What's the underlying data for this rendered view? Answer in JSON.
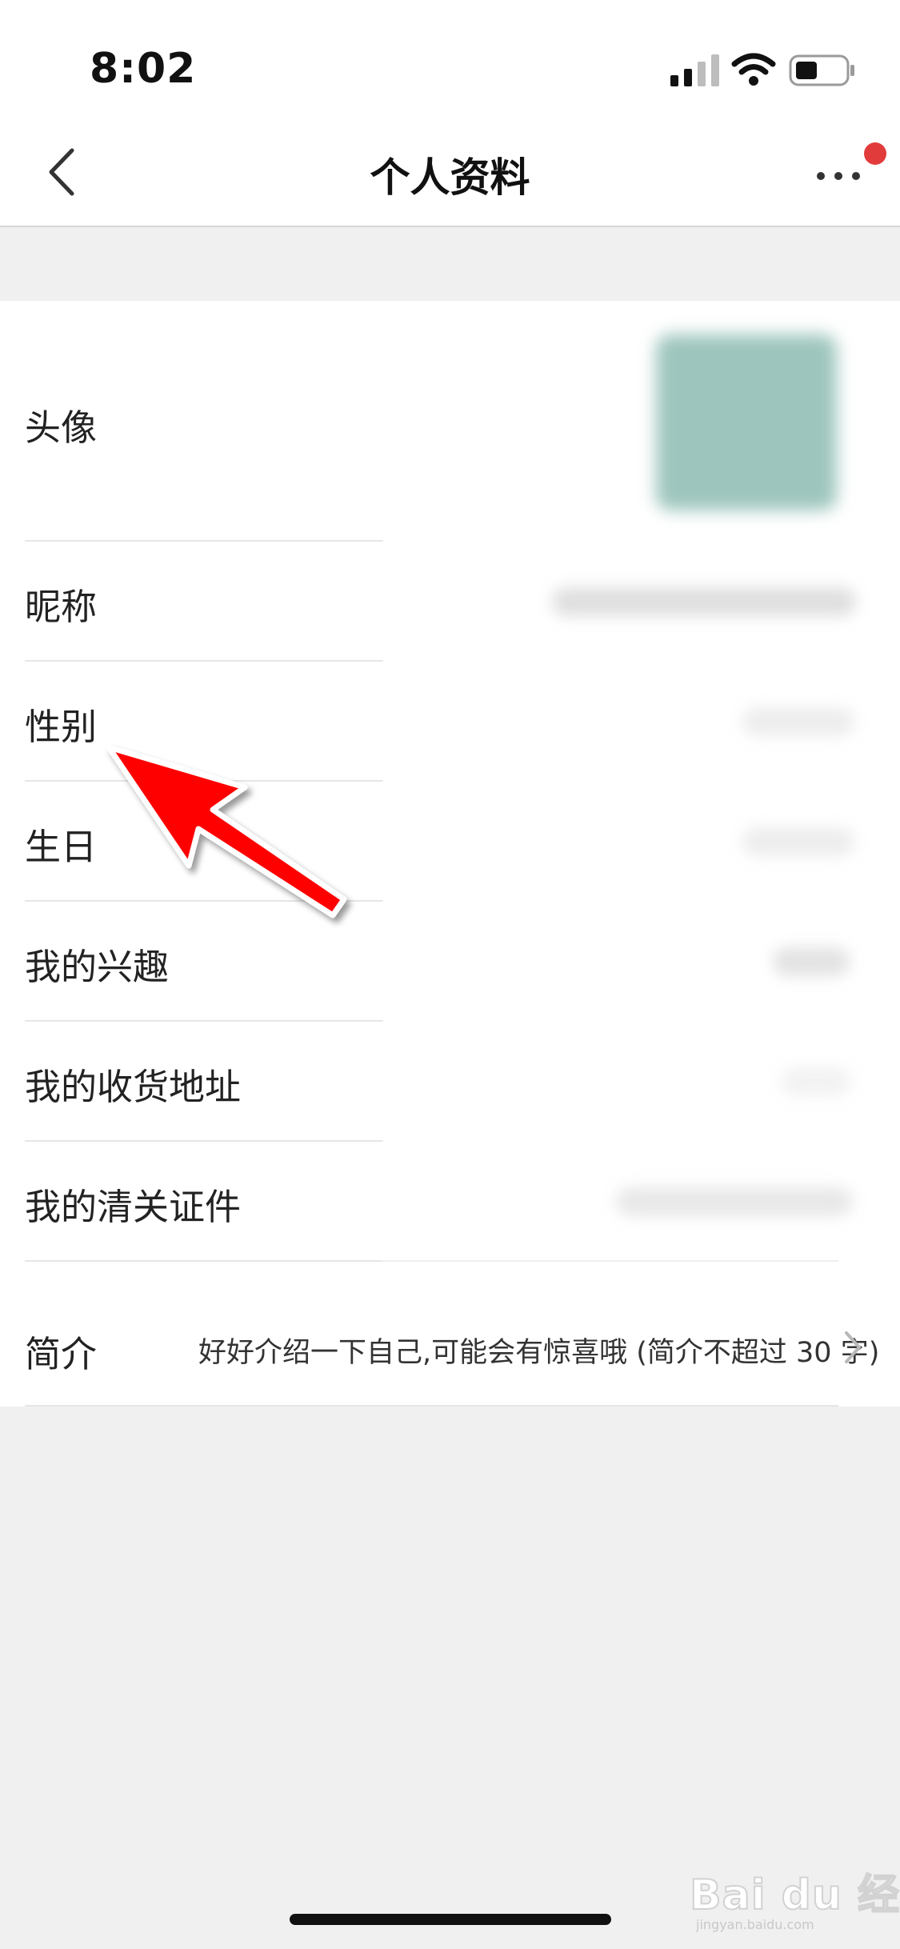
{
  "status_bar": {
    "time": "8:02",
    "signal_icon": "cellular-signal-icon",
    "wifi_icon": "wifi-icon",
    "battery_icon": "battery-icon"
  },
  "nav": {
    "title": "个人资料",
    "back_icon": "chevron-left-icon",
    "more_icon": "more-dots-icon",
    "has_notification_dot": true
  },
  "profile_rows": [
    {
      "label": "头像"
    },
    {
      "label": "昵称"
    },
    {
      "label": "性别"
    },
    {
      "label": "生日"
    },
    {
      "label": "我的兴趣"
    },
    {
      "label": "我的收货地址"
    },
    {
      "label": "我的清关证件"
    },
    {
      "label": "简介",
      "value": "好好介绍一下自己,可能会有惊喜哦 (简介不超过 30 字)"
    }
  ],
  "annotation": {
    "icon": "red-arrow-icon",
    "color": "#ff0000"
  },
  "watermark": {
    "logo_text": "Bai du 经验",
    "sub_text": "jingyan.baidu.com"
  },
  "colors": {
    "background": "#f0f0f0",
    "card": "#ffffff",
    "notification_dot": "#e23b3b",
    "arrow": "#ff0000"
  }
}
